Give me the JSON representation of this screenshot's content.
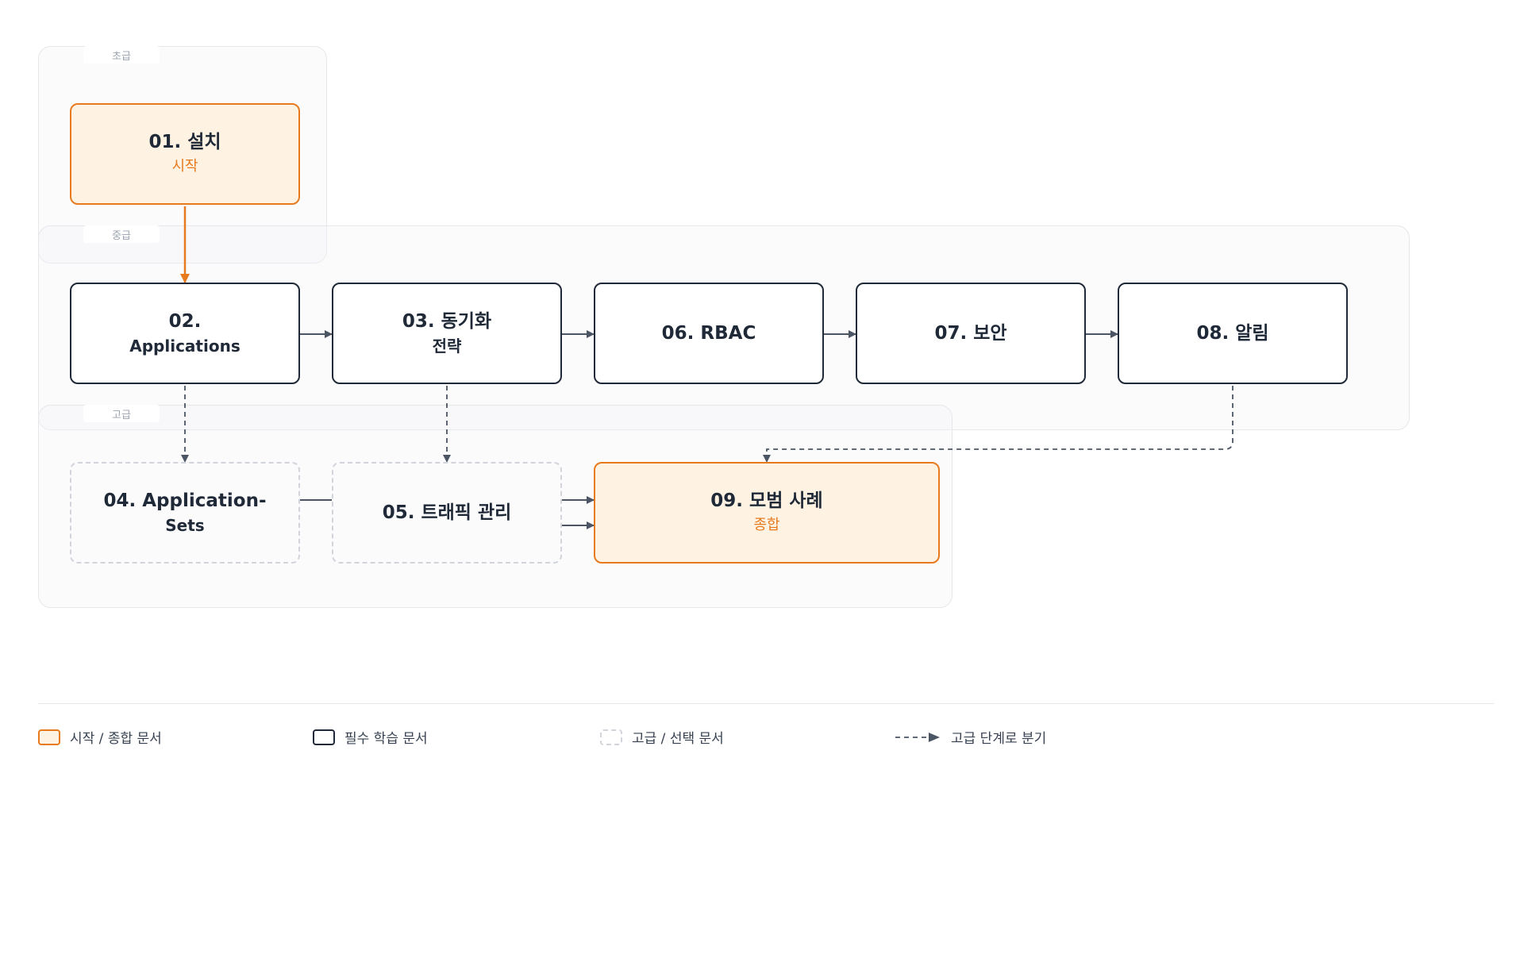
{
  "groups": {
    "beginner": "초급",
    "intermediate": "중급",
    "advanced": "고급"
  },
  "nodes": {
    "n01": {
      "title": "01. 설치",
      "sub": "시작"
    },
    "n02": {
      "title": "02.",
      "sub": "Applications"
    },
    "n03": {
      "title": "03. 동기화",
      "sub": "전략"
    },
    "n06": {
      "title": "06. RBAC"
    },
    "n07": {
      "title": "07. 보안"
    },
    "n08": {
      "title": "08. 알림"
    },
    "n04": {
      "title": "04. Application-",
      "sub": "Sets"
    },
    "n05": {
      "title": "05. 트래픽 관리"
    },
    "n09": {
      "title": "09. 모범 사례",
      "sub": "종합"
    }
  },
  "legend": {
    "start_end": "시작 / 종합 문서",
    "required": "필수 학습 문서",
    "optional": "고급 / 선택 문서",
    "branch": "고급 단계로 분기"
  },
  "colors": {
    "accent": "#e87a1e",
    "accent_fill": "#fef3e2",
    "line": "#4b5563",
    "dashed_border": "#d1d5db"
  }
}
